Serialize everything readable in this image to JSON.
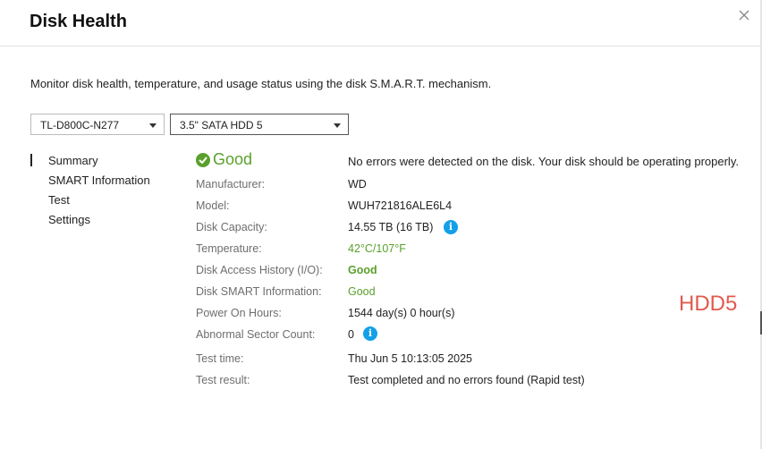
{
  "dialog": {
    "title": "Disk Health",
    "description": "Monitor disk health, temperature, and usage status using the disk S.M.A.R.T. mechanism."
  },
  "selectors": {
    "enclosure": "TL-D800C-N277",
    "disk": "3.5\" SATA HDD 5"
  },
  "nav": {
    "items": [
      {
        "label": "Summary",
        "active": true
      },
      {
        "label": "SMART Information",
        "active": false
      },
      {
        "label": "Test",
        "active": false
      },
      {
        "label": "Settings",
        "active": false
      }
    ]
  },
  "summary": {
    "status": "Good",
    "status_message": "No errors were detected on the disk. Your disk should be operating properly.",
    "fields": {
      "manufacturer": {
        "label": "Manufacturer:",
        "value": "WD"
      },
      "model": {
        "label": "Model:",
        "value": "WUH721816ALE6L4"
      },
      "capacity": {
        "label": "Disk Capacity:",
        "value": "14.55 TB (16 TB)"
      },
      "temperature": {
        "label": "Temperature:",
        "value": "42°C/107°F"
      },
      "access_history": {
        "label": "Disk Access History (I/O):",
        "value": "Good"
      },
      "smart_info": {
        "label": "Disk SMART Information:",
        "value": "Good"
      },
      "power_on_hours": {
        "label": "Power On Hours:",
        "value": "1544 day(s) 0 hour(s)"
      },
      "abnormal_sectors": {
        "label": "Abnormal Sector Count:",
        "value": "0"
      },
      "test_time": {
        "label": "Test time:",
        "value": "Thu Jun 5 10:13:05 2025"
      },
      "test_result": {
        "label": "Test result:",
        "value": "Test completed and no errors found (Rapid test)"
      }
    }
  },
  "annotation": "HDD5",
  "icons": {
    "close": "close-icon",
    "status": "check-circle-icon",
    "info": "info-icon"
  },
  "colors": {
    "good_green": "#5aa02c",
    "info_blue": "#12a0e8",
    "annotation_red": "#e05a4d"
  }
}
